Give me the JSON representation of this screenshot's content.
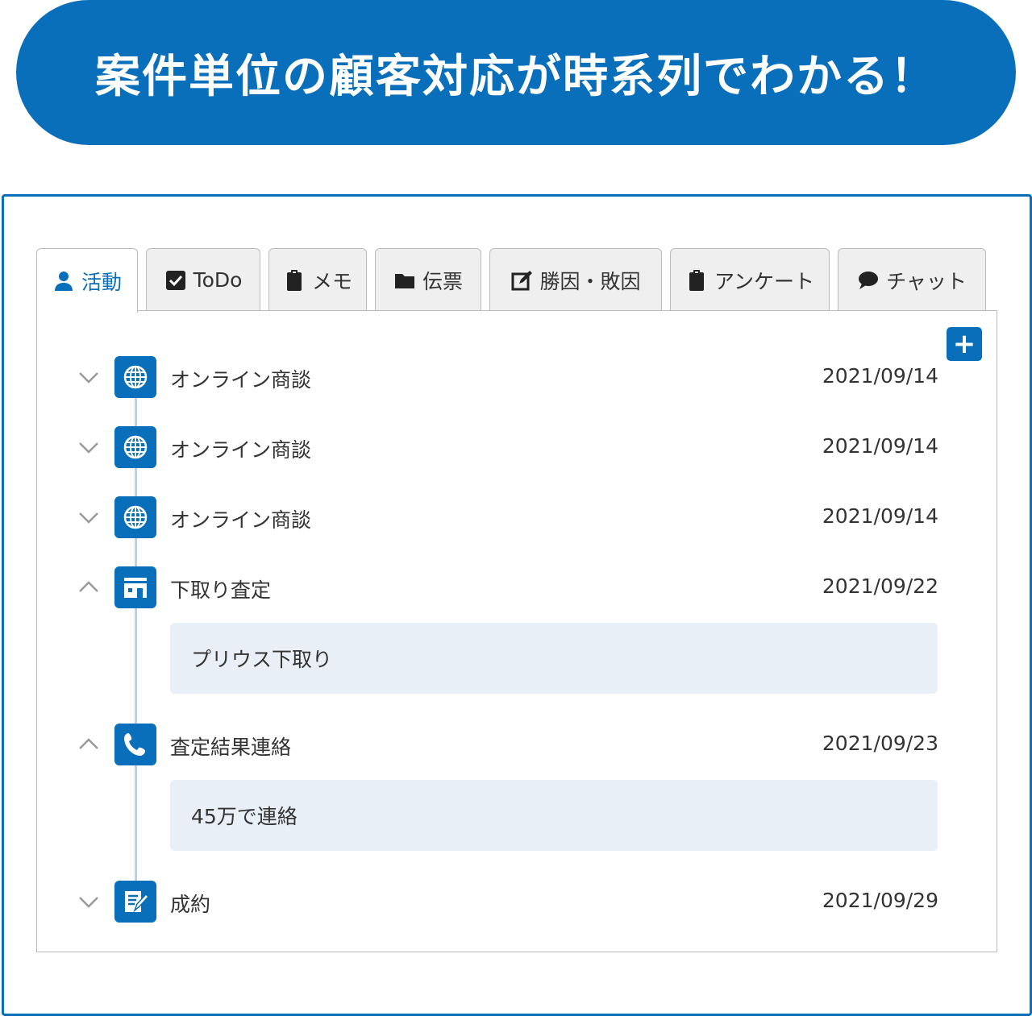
{
  "banner": {
    "title": "案件単位の顧客対応が時系列でわかる！"
  },
  "tabs": [
    {
      "label": "活動",
      "icon": "person-icon",
      "active": true
    },
    {
      "label": "ToDo",
      "icon": "checkbox-icon",
      "active": false
    },
    {
      "label": "メモ",
      "icon": "clipboard-icon",
      "active": false
    },
    {
      "label": "伝票",
      "icon": "folder-icon",
      "active": false
    },
    {
      "label": "勝因・敗因",
      "icon": "edit-icon",
      "active": false
    },
    {
      "label": "アンケート",
      "icon": "clipboard-icon",
      "active": false
    },
    {
      "label": "チャット",
      "icon": "chat-bubble-icon",
      "active": false
    }
  ],
  "panel": {
    "add_label": "+"
  },
  "timeline": [
    {
      "title": "オンライン商談",
      "date": "2021/09/14",
      "icon": "globe-icon",
      "expanded": false
    },
    {
      "title": "オンライン商談",
      "date": "2021/09/14",
      "icon": "globe-icon",
      "expanded": false
    },
    {
      "title": "オンライン商談",
      "date": "2021/09/14",
      "icon": "globe-icon",
      "expanded": false
    },
    {
      "title": "下取り査定",
      "date": "2021/09/22",
      "icon": "store-icon",
      "expanded": true,
      "note": "プリウス下取り"
    },
    {
      "title": "査定結果連絡",
      "date": "2021/09/23",
      "icon": "phone-icon",
      "expanded": true,
      "note": "45万で連絡"
    },
    {
      "title": "成約",
      "date": "2021/09/29",
      "icon": "contract-icon",
      "expanded": false
    }
  ],
  "colors": {
    "accent": "#0a6fba",
    "timeline_line": "#b8d3ea",
    "note_bg": "#e8eff6"
  }
}
